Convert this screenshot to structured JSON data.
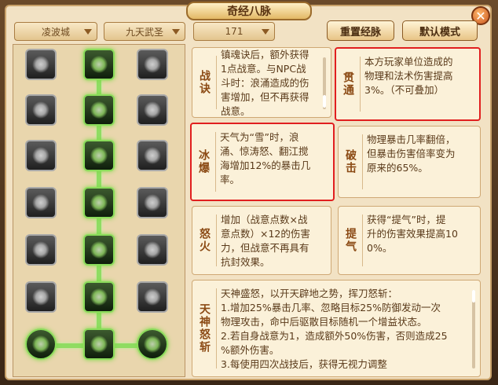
{
  "window": {
    "title": "奇经八脉",
    "close_glyph": "✕"
  },
  "filters": {
    "sect": "凌波城",
    "school": "九天武圣",
    "level": "171"
  },
  "buttons": {
    "reset": "重置经脉",
    "default_mode": "默认模式"
  },
  "cards": {
    "zhanjue": {
      "label": "战诀",
      "text": "镇魂诀后，额外获得\n1点战意。与NPC战\n斗时：浪涌造成的伤\n害增加，但不再获得\n战意。"
    },
    "guantong": {
      "label": "贯通",
      "text": "本方玩家单位造成的\n物理和法术伤害提高\n3%。（不可叠加）"
    },
    "bingbao": {
      "label": "冰爆",
      "text": "天气为“雪”时，浪\n涌、惊涛怒、翻江搅\n海增加12%的暴击几\n率。"
    },
    "poji": {
      "label": "破击",
      "text": "物理暴击几率翻倍，\n但暴击伤害倍率变为\n原来的65%。"
    },
    "nuhuo": {
      "label": "怒火",
      "text": "增加（战意点数×战\n意点数）×12的伤害\n力，但战意不再具有\n抗封效果。"
    },
    "tiqi": {
      "label": "提气",
      "text": "获得“提气”时，提\n升的伤害效果提高10\n0%。"
    },
    "tianshen": {
      "label": "天神怒斩",
      "text": "天神盛怒，以开天辟地之势，挥刀怒斩：\n1.增加25%暴击几率、忽略目标25%防御发动一次\n物理攻击，命中后驱散目标随机一个增益状态。\n2.若自身战意为1，造成额外50%伤害，否则造成25\n%额外伤害。\n3.每使用四次战技后，获得无视力调整"
    }
  },
  "tree": {
    "node_icons": [
      [
        "fist-icon",
        "banner-icon",
        "monk-icon"
      ],
      [
        "spiral-icon",
        "warrior-icon",
        "swirl-icon"
      ],
      [
        "muscle-icon",
        "snowflake-icon",
        "dragon-icon"
      ],
      [
        "blades-icon",
        "wave-slash-icon",
        "cloud-icon"
      ],
      [
        "flame-icon",
        "burst-icon",
        "mountain-icon"
      ],
      [
        "arrows-icon",
        "lightning-icon",
        "meditate-icon"
      ],
      [
        "orb-icon",
        "claw-slash-icon",
        "orb-icon"
      ]
    ],
    "active": [
      [
        false,
        true,
        false
      ],
      [
        false,
        true,
        false
      ],
      [
        false,
        true,
        false
      ],
      [
        false,
        true,
        false
      ],
      [
        false,
        true,
        false
      ],
      [
        false,
        true,
        false
      ],
      [
        true,
        true,
        true
      ]
    ]
  },
  "colors": {
    "highlight": "#e11f1f",
    "active_glow": "#8fdc62",
    "label": "#8b4a14"
  }
}
